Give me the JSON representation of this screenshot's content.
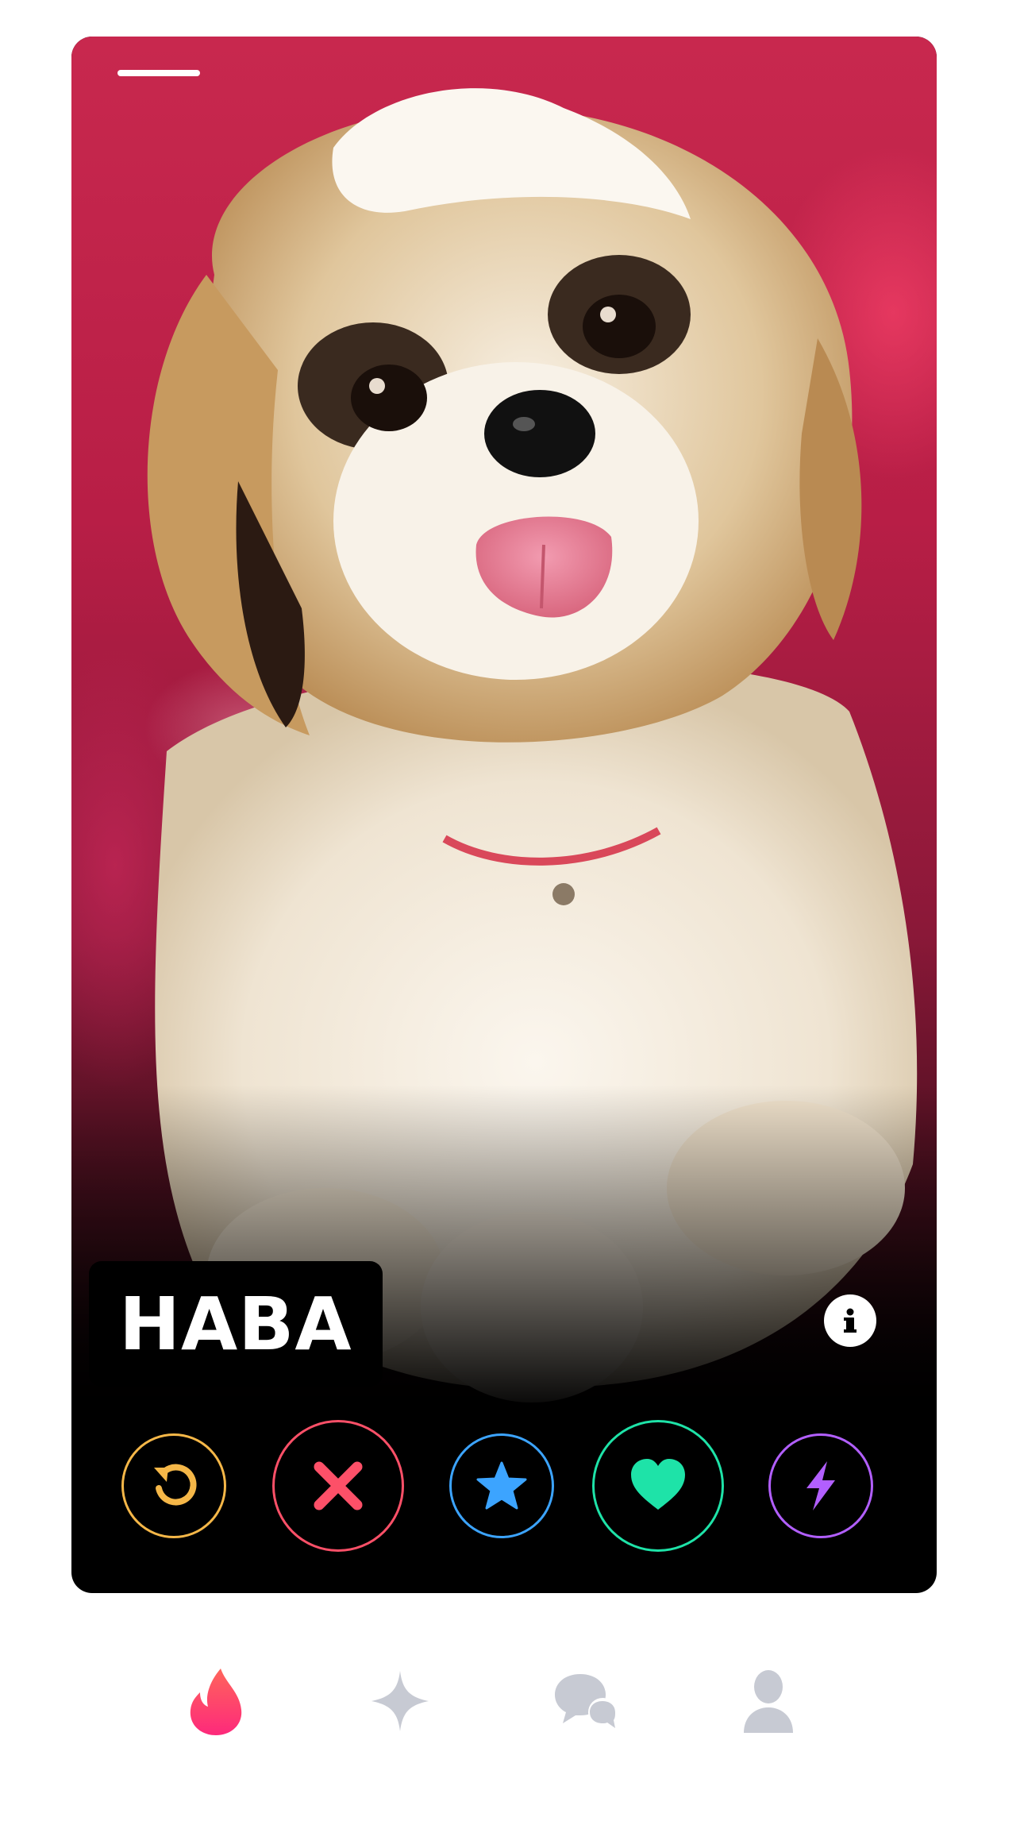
{
  "app": {
    "brand_gradient": [
      "#fd297b",
      "#ff655b"
    ]
  },
  "profile": {
    "name": "HABA",
    "photo_count_shown": 1,
    "active_photo_index": 1
  },
  "actions": [
    {
      "id": "rewind",
      "icon": "rewind-icon",
      "color": "#f5b748"
    },
    {
      "id": "nope",
      "icon": "x-icon",
      "color": "#fd5068"
    },
    {
      "id": "super-like",
      "icon": "star-icon",
      "color": "#3ca4ff"
    },
    {
      "id": "like",
      "icon": "heart-icon",
      "color": "#1ee3a8"
    },
    {
      "id": "boost",
      "icon": "lightning-icon",
      "color": "#b25fff"
    }
  ],
  "tabs": [
    {
      "id": "discover",
      "icon": "flame-icon",
      "active": true
    },
    {
      "id": "explore",
      "icon": "sparkle-icon",
      "active": false
    },
    {
      "id": "messages",
      "icon": "chat-bubbles-icon",
      "active": false
    },
    {
      "id": "profile",
      "icon": "person-icon",
      "active": false
    }
  ],
  "colors": {
    "inactive_tab": "#c7cad3",
    "card_background": "#000000",
    "name_text": "#ffffff"
  }
}
